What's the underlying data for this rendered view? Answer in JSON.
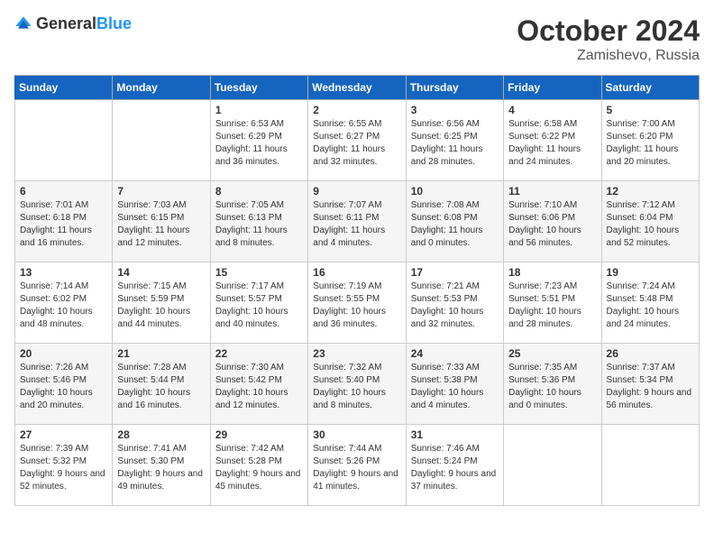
{
  "header": {
    "logo_general": "General",
    "logo_blue": "Blue",
    "month": "October 2024",
    "location": "Zamishevo, Russia"
  },
  "weekdays": [
    "Sunday",
    "Monday",
    "Tuesday",
    "Wednesday",
    "Thursday",
    "Friday",
    "Saturday"
  ],
  "weeks": [
    [
      {
        "day": "",
        "info": ""
      },
      {
        "day": "",
        "info": ""
      },
      {
        "day": "1",
        "info": "Sunrise: 6:53 AM\nSunset: 6:29 PM\nDaylight: 11 hours and 36 minutes."
      },
      {
        "day": "2",
        "info": "Sunrise: 6:55 AM\nSunset: 6:27 PM\nDaylight: 11 hours and 32 minutes."
      },
      {
        "day": "3",
        "info": "Sunrise: 6:56 AM\nSunset: 6:25 PM\nDaylight: 11 hours and 28 minutes."
      },
      {
        "day": "4",
        "info": "Sunrise: 6:58 AM\nSunset: 6:22 PM\nDaylight: 11 hours and 24 minutes."
      },
      {
        "day": "5",
        "info": "Sunrise: 7:00 AM\nSunset: 6:20 PM\nDaylight: 11 hours and 20 minutes."
      }
    ],
    [
      {
        "day": "6",
        "info": "Sunrise: 7:01 AM\nSunset: 6:18 PM\nDaylight: 11 hours and 16 minutes."
      },
      {
        "day": "7",
        "info": "Sunrise: 7:03 AM\nSunset: 6:15 PM\nDaylight: 11 hours and 12 minutes."
      },
      {
        "day": "8",
        "info": "Sunrise: 7:05 AM\nSunset: 6:13 PM\nDaylight: 11 hours and 8 minutes."
      },
      {
        "day": "9",
        "info": "Sunrise: 7:07 AM\nSunset: 6:11 PM\nDaylight: 11 hours and 4 minutes."
      },
      {
        "day": "10",
        "info": "Sunrise: 7:08 AM\nSunset: 6:08 PM\nDaylight: 11 hours and 0 minutes."
      },
      {
        "day": "11",
        "info": "Sunrise: 7:10 AM\nSunset: 6:06 PM\nDaylight: 10 hours and 56 minutes."
      },
      {
        "day": "12",
        "info": "Sunrise: 7:12 AM\nSunset: 6:04 PM\nDaylight: 10 hours and 52 minutes."
      }
    ],
    [
      {
        "day": "13",
        "info": "Sunrise: 7:14 AM\nSunset: 6:02 PM\nDaylight: 10 hours and 48 minutes."
      },
      {
        "day": "14",
        "info": "Sunrise: 7:15 AM\nSunset: 5:59 PM\nDaylight: 10 hours and 44 minutes."
      },
      {
        "day": "15",
        "info": "Sunrise: 7:17 AM\nSunset: 5:57 PM\nDaylight: 10 hours and 40 minutes."
      },
      {
        "day": "16",
        "info": "Sunrise: 7:19 AM\nSunset: 5:55 PM\nDaylight: 10 hours and 36 minutes."
      },
      {
        "day": "17",
        "info": "Sunrise: 7:21 AM\nSunset: 5:53 PM\nDaylight: 10 hours and 32 minutes."
      },
      {
        "day": "18",
        "info": "Sunrise: 7:23 AM\nSunset: 5:51 PM\nDaylight: 10 hours and 28 minutes."
      },
      {
        "day": "19",
        "info": "Sunrise: 7:24 AM\nSunset: 5:48 PM\nDaylight: 10 hours and 24 minutes."
      }
    ],
    [
      {
        "day": "20",
        "info": "Sunrise: 7:26 AM\nSunset: 5:46 PM\nDaylight: 10 hours and 20 minutes."
      },
      {
        "day": "21",
        "info": "Sunrise: 7:28 AM\nSunset: 5:44 PM\nDaylight: 10 hours and 16 minutes."
      },
      {
        "day": "22",
        "info": "Sunrise: 7:30 AM\nSunset: 5:42 PM\nDaylight: 10 hours and 12 minutes."
      },
      {
        "day": "23",
        "info": "Sunrise: 7:32 AM\nSunset: 5:40 PM\nDaylight: 10 hours and 8 minutes."
      },
      {
        "day": "24",
        "info": "Sunrise: 7:33 AM\nSunset: 5:38 PM\nDaylight: 10 hours and 4 minutes."
      },
      {
        "day": "25",
        "info": "Sunrise: 7:35 AM\nSunset: 5:36 PM\nDaylight: 10 hours and 0 minutes."
      },
      {
        "day": "26",
        "info": "Sunrise: 7:37 AM\nSunset: 5:34 PM\nDaylight: 9 hours and 56 minutes."
      }
    ],
    [
      {
        "day": "27",
        "info": "Sunrise: 7:39 AM\nSunset: 5:32 PM\nDaylight: 9 hours and 52 minutes."
      },
      {
        "day": "28",
        "info": "Sunrise: 7:41 AM\nSunset: 5:30 PM\nDaylight: 9 hours and 49 minutes."
      },
      {
        "day": "29",
        "info": "Sunrise: 7:42 AM\nSunset: 5:28 PM\nDaylight: 9 hours and 45 minutes."
      },
      {
        "day": "30",
        "info": "Sunrise: 7:44 AM\nSunset: 5:26 PM\nDaylight: 9 hours and 41 minutes."
      },
      {
        "day": "31",
        "info": "Sunrise: 7:46 AM\nSunset: 5:24 PM\nDaylight: 9 hours and 37 minutes."
      },
      {
        "day": "",
        "info": ""
      },
      {
        "day": "",
        "info": ""
      }
    ]
  ]
}
